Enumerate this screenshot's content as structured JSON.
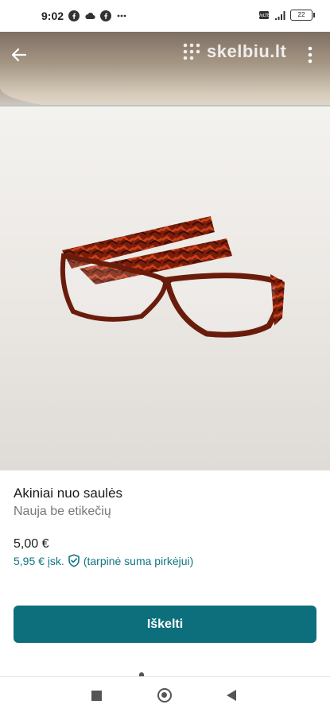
{
  "status_bar": {
    "time": "9:02",
    "battery": "22",
    "network": "5G",
    "icons": [
      "facebook-icon",
      "cloud-icon",
      "facebook-icon",
      "more-dots-icon",
      "volte-icon",
      "signal-icon",
      "battery-icon"
    ]
  },
  "toolbar": {
    "logo_text": "skelbiu.lt",
    "back_icon": "arrow-left-icon",
    "menu_icon": "kebab-menu-icon"
  },
  "gallery": {
    "image_count": 4,
    "active_index": 0
  },
  "listing": {
    "title": "Akiniai nuo saulės",
    "condition": "Nauja be etikečių",
    "price": "5,00 €",
    "price_total": "5,95 € įsk.",
    "price_note": "(tarpinė suma pirkėjui)"
  },
  "actions": {
    "raise_label": "Iškelti"
  },
  "colors": {
    "accent": "#0e6f7c",
    "link": "#0f7481"
  }
}
